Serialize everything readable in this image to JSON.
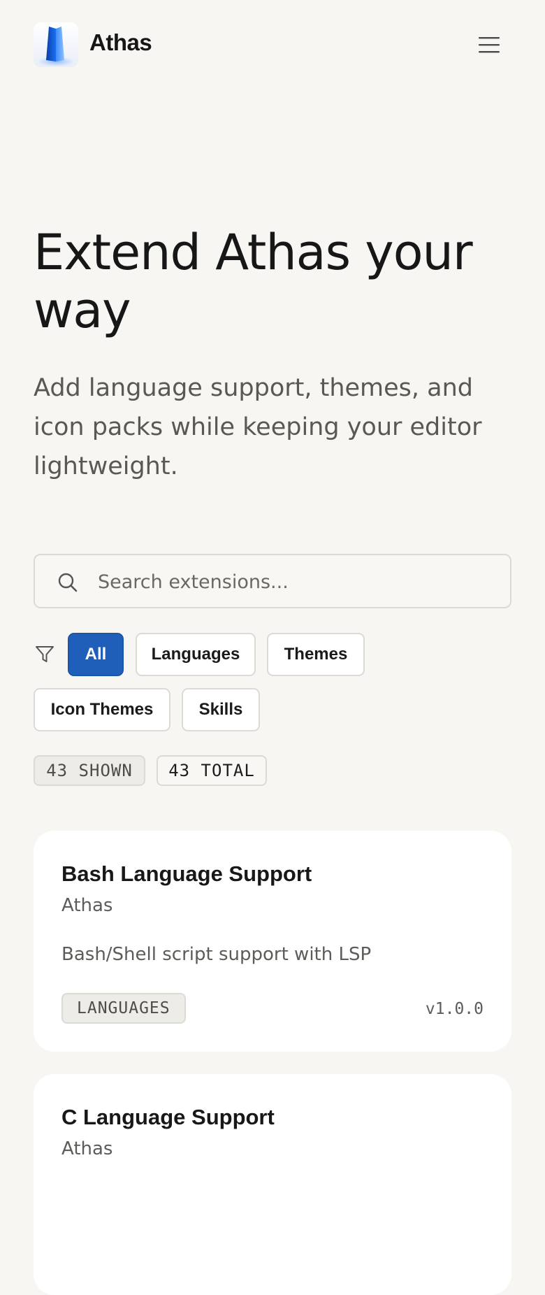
{
  "header": {
    "brand": "Athas",
    "logo_icon": "athas-logo-icon",
    "menu_icon": "hamburger-menu-icon"
  },
  "hero": {
    "title": "Extend Athas your way",
    "subtitle": "Add language support, themes, and icon packs while keeping your editor lightweight."
  },
  "search": {
    "icon": "search-icon",
    "placeholder": "Search extensions...",
    "value": ""
  },
  "filters": {
    "icon": "filter-icon",
    "active": "All",
    "items": [
      "All",
      "Languages",
      "Themes",
      "Icon Themes",
      "Skills"
    ]
  },
  "stats": {
    "shown": "43 SHOWN",
    "total": "43 TOTAL"
  },
  "extensions": [
    {
      "title": "Bash Language Support",
      "author": "Athas",
      "description": "Bash/Shell script support with LSP",
      "category": "LANGUAGES",
      "version": "v1.0.0"
    },
    {
      "title": "C Language Support",
      "author": "Athas",
      "description": "",
      "category": "",
      "version": ""
    }
  ],
  "colors": {
    "background": "#f7f6f3",
    "accent": "#1f5fba",
    "card": "#ffffff",
    "border": "#dcdad5"
  }
}
